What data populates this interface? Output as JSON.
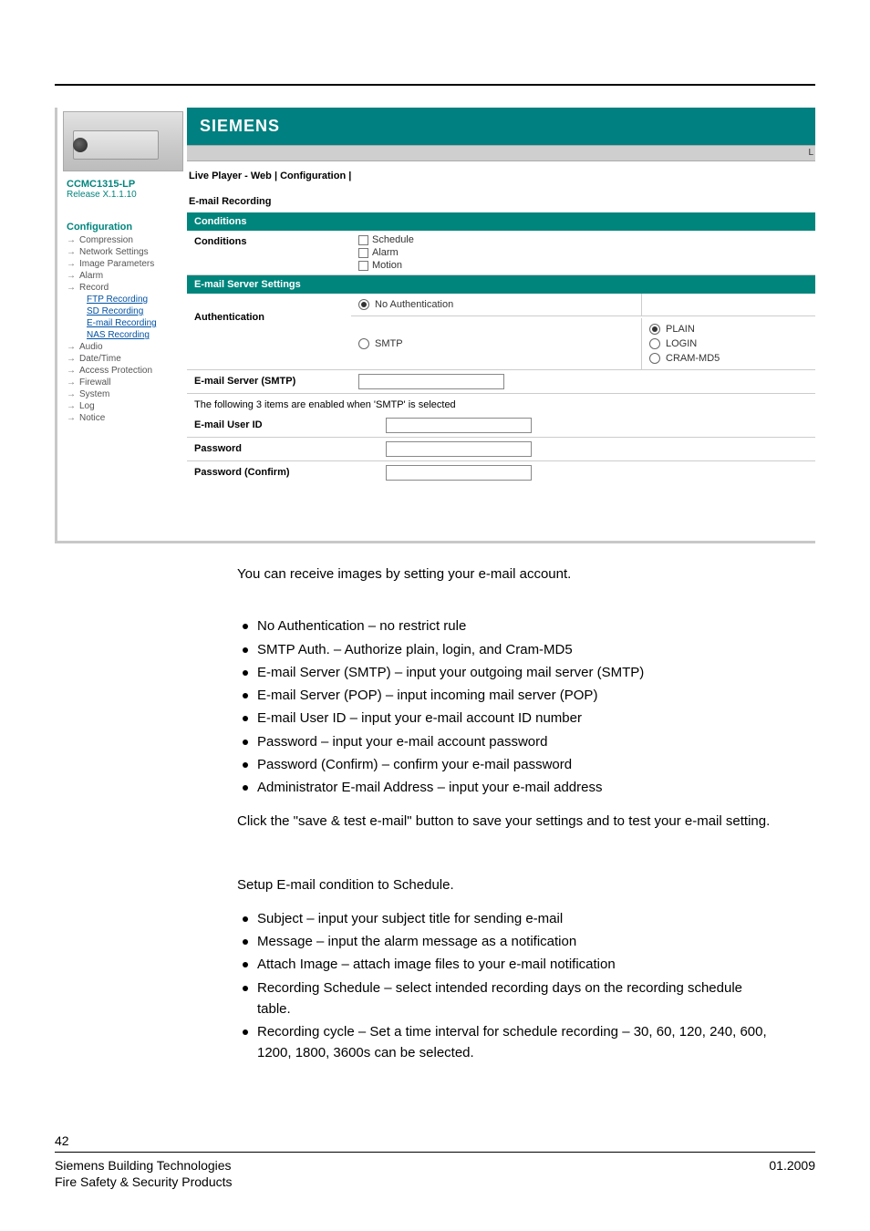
{
  "sidebar": {
    "model": "CCMC1315-LP",
    "release": "Release X.1.1.10",
    "configHeading": "Configuration",
    "items": [
      {
        "label": "Compression",
        "type": "top"
      },
      {
        "label": "Network Settings",
        "type": "top"
      },
      {
        "label": "Image Parameters",
        "type": "top"
      },
      {
        "label": "Alarm",
        "type": "top"
      },
      {
        "label": "Record",
        "type": "top"
      },
      {
        "label": "FTP Recording",
        "type": "sub"
      },
      {
        "label": "SD Recording",
        "type": "sub"
      },
      {
        "label": "E-mail Recording",
        "type": "sub"
      },
      {
        "label": "NAS Recording",
        "type": "sub"
      },
      {
        "label": "Audio",
        "type": "top"
      },
      {
        "label": "Date/Time",
        "type": "top"
      },
      {
        "label": "Access Protection",
        "type": "top"
      },
      {
        "label": "Firewall",
        "type": "top"
      },
      {
        "label": "System",
        "type": "top"
      },
      {
        "label": "Log",
        "type": "top"
      },
      {
        "label": "Notice",
        "type": "top"
      }
    ]
  },
  "header": {
    "brand": "SIEMENS",
    "subbarRight": "L",
    "crumb": "Live Player - Web  |  Configuration  |"
  },
  "section": {
    "pageTitle": "E-mail Recording",
    "conditionsBar": "Conditions",
    "conditionsLabel": "Conditions",
    "conditionsOpts": [
      "Schedule",
      "Alarm",
      "Motion"
    ],
    "serverBar": "E-mail Server Settings",
    "authLabel": "Authentication",
    "authNoAuth": "No Authentication",
    "authSmtp": "SMTP",
    "authModes": [
      "PLAIN",
      "LOGIN",
      "CRAM-MD5"
    ],
    "smtpServerLabel": "E-mail Server (SMTP)",
    "note": "The following 3 items are enabled when 'SMTP' is selected",
    "userIdLabel": "E-mail User ID",
    "passwordLabel": "Password",
    "passwordConfirmLabel": "Password (Confirm)"
  },
  "doc": {
    "intro": "You can receive images by setting your e-mail account.",
    "bullets1": [
      "No Authentication – no restrict rule",
      "SMTP Auth. – Authorize plain, login, and Cram-MD5",
      "E-mail Server (SMTP) – input your outgoing mail server (SMTP)",
      "E-mail Server (POP) – input incoming mail server (POP)",
      "E-mail User ID – input your e-mail account ID number",
      "Password – input your e-mail account password",
      "Password (Confirm) – confirm your e-mail password",
      "Administrator E-mail Address – input your e-mail address"
    ],
    "para1": "Click the \"save & test e-mail\" button to save your settings and to test your e-mail setting.",
    "para2": "Setup E-mail condition to Schedule.",
    "bullets2": [
      "Subject – input your subject title for sending e-mail",
      "Message – input the alarm message as a notification",
      "Attach Image – attach image files to your e-mail notification",
      "Recording Schedule – select intended recording days on the recording schedule table.",
      "Recording cycle – Set a time interval for schedule recording – 30, 60, 120, 240, 600, 1200, 1800, 3600s can be selected."
    ]
  },
  "footer": {
    "pageNumber": "42",
    "line1": "Siemens Building Technologies",
    "line2": "Fire Safety & Security Products",
    "date": "01.2009"
  }
}
